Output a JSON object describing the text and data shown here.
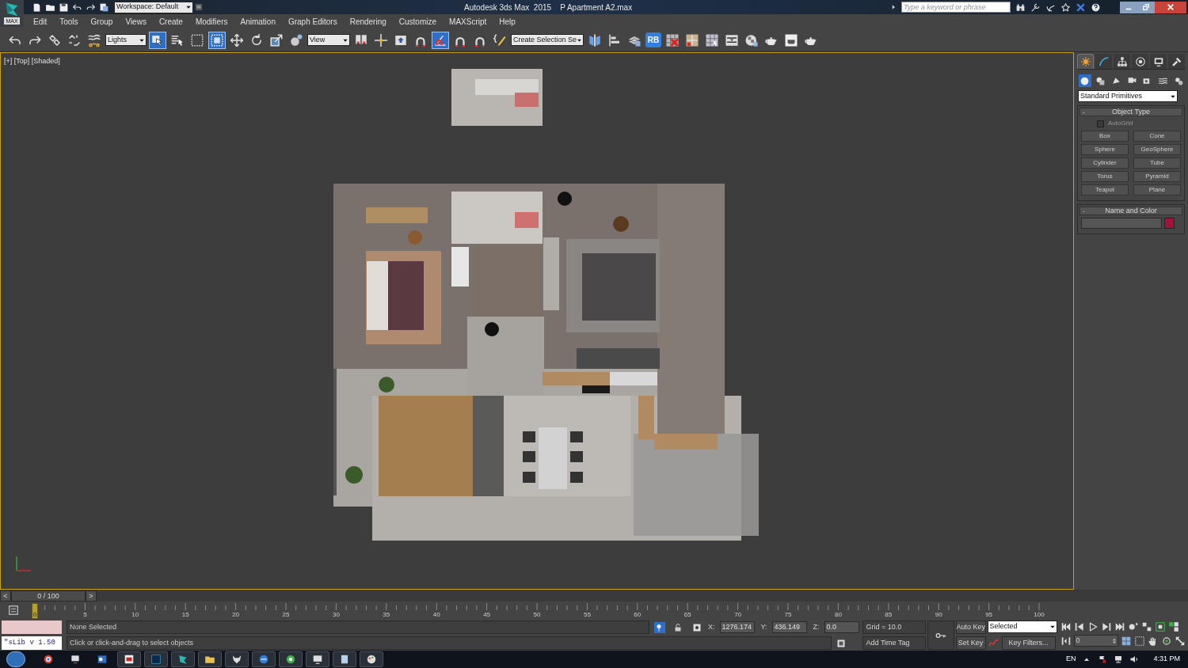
{
  "title_bar": {
    "logo_label": "MAX",
    "workspace": "Workspace: Default",
    "title": "Autodesk 3ds Max  2015    P Apartment A2.max",
    "search": {
      "placeholder": "Type a keyword or phrase"
    }
  },
  "menu": [
    "Edit",
    "Tools",
    "Group",
    "Views",
    "Create",
    "Modifiers",
    "Animation",
    "Graph Editors",
    "Rendering",
    "Customize",
    "MAXScript",
    "Help"
  ],
  "toolbar": [
    {
      "kind": "undo"
    },
    {
      "kind": "redo"
    },
    {
      "kind": "link"
    },
    {
      "kind": "unlink"
    },
    {
      "kind": "bind"
    },
    {
      "kind": "dropdown",
      "value": "Lights"
    },
    {
      "kind": "select",
      "active": true
    },
    {
      "kind": "select_by_name",
      "active": false
    },
    {
      "kind": "region",
      "active": false
    },
    {
      "kind": "crossing",
      "active": true
    },
    {
      "kind": "move",
      "active": false
    },
    {
      "kind": "rotate",
      "active": false
    },
    {
      "kind": "scale",
      "active": false
    },
    {
      "kind": "place"
    },
    {
      "kind": "dropdown",
      "value": "View"
    },
    {
      "kind": "pivot"
    },
    {
      "kind": "manipulate"
    },
    {
      "kind": "shortcut"
    },
    {
      "kind": "snap",
      "active": false
    },
    {
      "kind": "angle_snap",
      "active": true
    },
    {
      "kind": "snap",
      "active": false
    },
    {
      "kind": "snap",
      "active": false
    },
    {
      "kind": "edit_named"
    },
    {
      "kind": "dropdown",
      "value": "Create Selection Se"
    },
    {
      "kind": "mirror"
    },
    {
      "kind": "align"
    },
    {
      "kind": "layers"
    },
    {
      "kind": "text",
      "value": "RB"
    },
    {
      "kind": "grid_x"
    },
    {
      "kind": "rig"
    },
    {
      "kind": "grid"
    },
    {
      "kind": "ribbon"
    },
    {
      "kind": "material"
    },
    {
      "kind": "teapot"
    },
    {
      "kind": "frame"
    },
    {
      "kind": "teapot"
    }
  ],
  "viewport": {
    "label": "[+] [Top] [Shaded]",
    "active": true
  },
  "command_panel": {
    "tabs": [
      {
        "kind": "create",
        "selected": true
      },
      {
        "kind": "modify",
        "selected": false
      },
      {
        "kind": "hierarchy",
        "selected": false
      },
      {
        "kind": "motion",
        "selected": false
      },
      {
        "kind": "display",
        "selected": false
      },
      {
        "kind": "utilities",
        "selected": false
      }
    ],
    "categories": [
      {
        "kind": "geometry",
        "selected": true
      },
      {
        "kind": "shapes",
        "selected": false
      },
      {
        "kind": "lights",
        "selected": false
      },
      {
        "kind": "cameras",
        "selected": false
      },
      {
        "kind": "helpers",
        "selected": false
      },
      {
        "kind": "spacewarps",
        "selected": false
      },
      {
        "kind": "systems",
        "selected": false
      }
    ],
    "subcategory": "Standard Primitives",
    "object_type": {
      "title": "Object Type",
      "toggle": "-",
      "autogrid": {
        "label": "AutoGrid",
        "checked": false
      },
      "buttons": [
        "Box",
        "Cone",
        "Sphere",
        "GeoSphere",
        "Cylinder",
        "Tube",
        "Torus",
        "Pyramid",
        "Teapot",
        "Plane"
      ]
    },
    "name_and_color": {
      "title": "Name and Color",
      "toggle": "-",
      "color": "#a0143c"
    }
  },
  "time_slider": {
    "label": "0 / 100",
    "prev": "<",
    "next": ">"
  },
  "track_ticks": [
    "0",
    "5",
    "10",
    "15",
    "20",
    "25",
    "30",
    "35",
    "40",
    "45",
    "50",
    "55",
    "60",
    "65",
    "70",
    "75",
    "80",
    "85",
    "90",
    "95",
    "100"
  ],
  "status": {
    "script_listener": "\"sLib v 1.50",
    "selection": "None Selected",
    "prompt": "Click or click-and-drag to select objects",
    "coords": [
      {
        "label": "X:",
        "value": "1276.174"
      },
      {
        "label": "Y:",
        "value": "436.149"
      },
      {
        "label": "Z:",
        "value": "0.0"
      }
    ],
    "grid": "Grid = 10.0",
    "add_time_tag": "Add Time Tag",
    "auto_key": "Auto Key",
    "set_key": "Set Key",
    "key_mode": "Selected",
    "key_filters": "Key Filters...",
    "frame": "0"
  },
  "taskbar": {
    "language": "EN",
    "clock": "4:31 PM"
  }
}
